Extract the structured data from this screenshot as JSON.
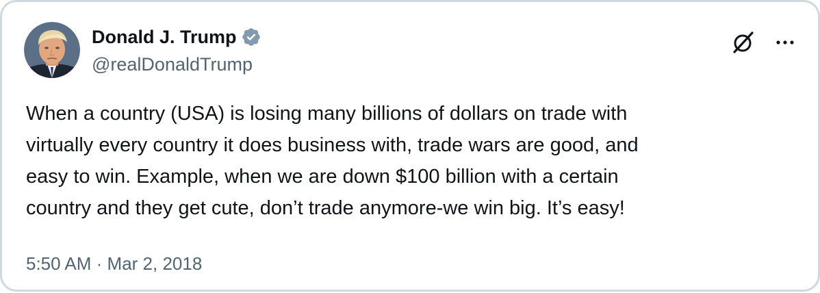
{
  "author": {
    "display_name": "Donald J. Trump",
    "handle": "@realDonaldTrump",
    "verified": true,
    "verified_badge_color": "#829aab",
    "avatar_icon": "profile-photo"
  },
  "tweet": {
    "text_lines": [
      "When a country (USA) is losing many billions of dollars on trade with",
      "virtually every country it does business with, trade wars are good, and",
      "easy to win. Example, when we are down $100 billion with a certain",
      "country and they get cute, don’t trade anymore-we win big. It’s easy!"
    ],
    "time": "5:50 AM",
    "separator": "·",
    "date": "Mar 2, 2018"
  },
  "actions": {
    "grok_icon": "grok-icon",
    "more_icon": "more-icon"
  },
  "colors": {
    "text_primary": "#0f1419",
    "text_secondary": "#536471",
    "border": "#cfd9de",
    "background": "#ffffff"
  }
}
